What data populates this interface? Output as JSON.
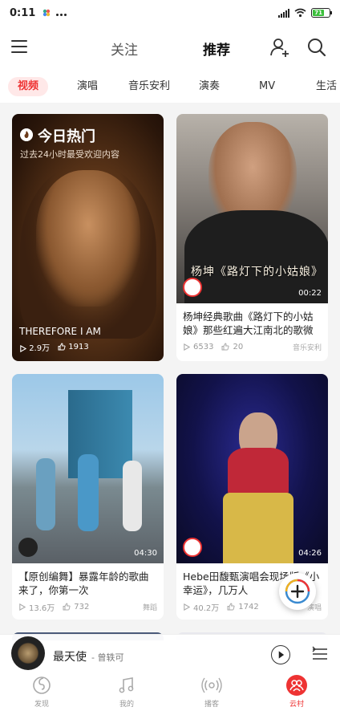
{
  "status_bar": {
    "time": "0:11",
    "battery": "71"
  },
  "header": {
    "tabs": [
      "关注",
      "推荐"
    ],
    "active_tab": "推荐"
  },
  "categories": [
    "视频",
    "演唱",
    "音乐安利",
    "演奏",
    "MV",
    "生活"
  ],
  "hot_card": {
    "title": "今日热门",
    "subtitle": "过去24小时最受欢迎内容",
    "song": "THEREFORE I AM",
    "plays": "2.9万",
    "likes": "1913"
  },
  "cards": [
    {
      "overlay": "杨坤《路灯下的小姑娘》",
      "duration": "00:22",
      "caption": "杨坤经典歌曲《路灯下的小姑娘》那些红遍大江南北的歌微爆全场！",
      "plays": "6533",
      "likes": "20",
      "tag": "音乐安利"
    },
    {
      "overlay": "",
      "duration": "04:30",
      "caption": "【原创编舞】暴露年龄的歌曲来了，你第一次",
      "plays": "13.6万",
      "likes": "732",
      "tag": "舞蹈"
    },
    {
      "overlay": "",
      "duration": "04:26",
      "caption": "Hebe田馥甄演唱会现场版《小幸运》，几万人",
      "plays": "40.2万",
      "likes": "1742",
      "tag": "演唱"
    }
  ],
  "player": {
    "song": "最天使",
    "artist": "- 曾轶可"
  },
  "bottom_nav": [
    {
      "label": "发现",
      "icon": "netease-logo-icon"
    },
    {
      "label": "我的",
      "icon": "music-note-icon"
    },
    {
      "label": "播客",
      "icon": "podcast-icon"
    },
    {
      "label": "云村",
      "icon": "community-icon"
    }
  ],
  "colors": {
    "accent": "#ee3333",
    "background": "#f4f4f4"
  }
}
